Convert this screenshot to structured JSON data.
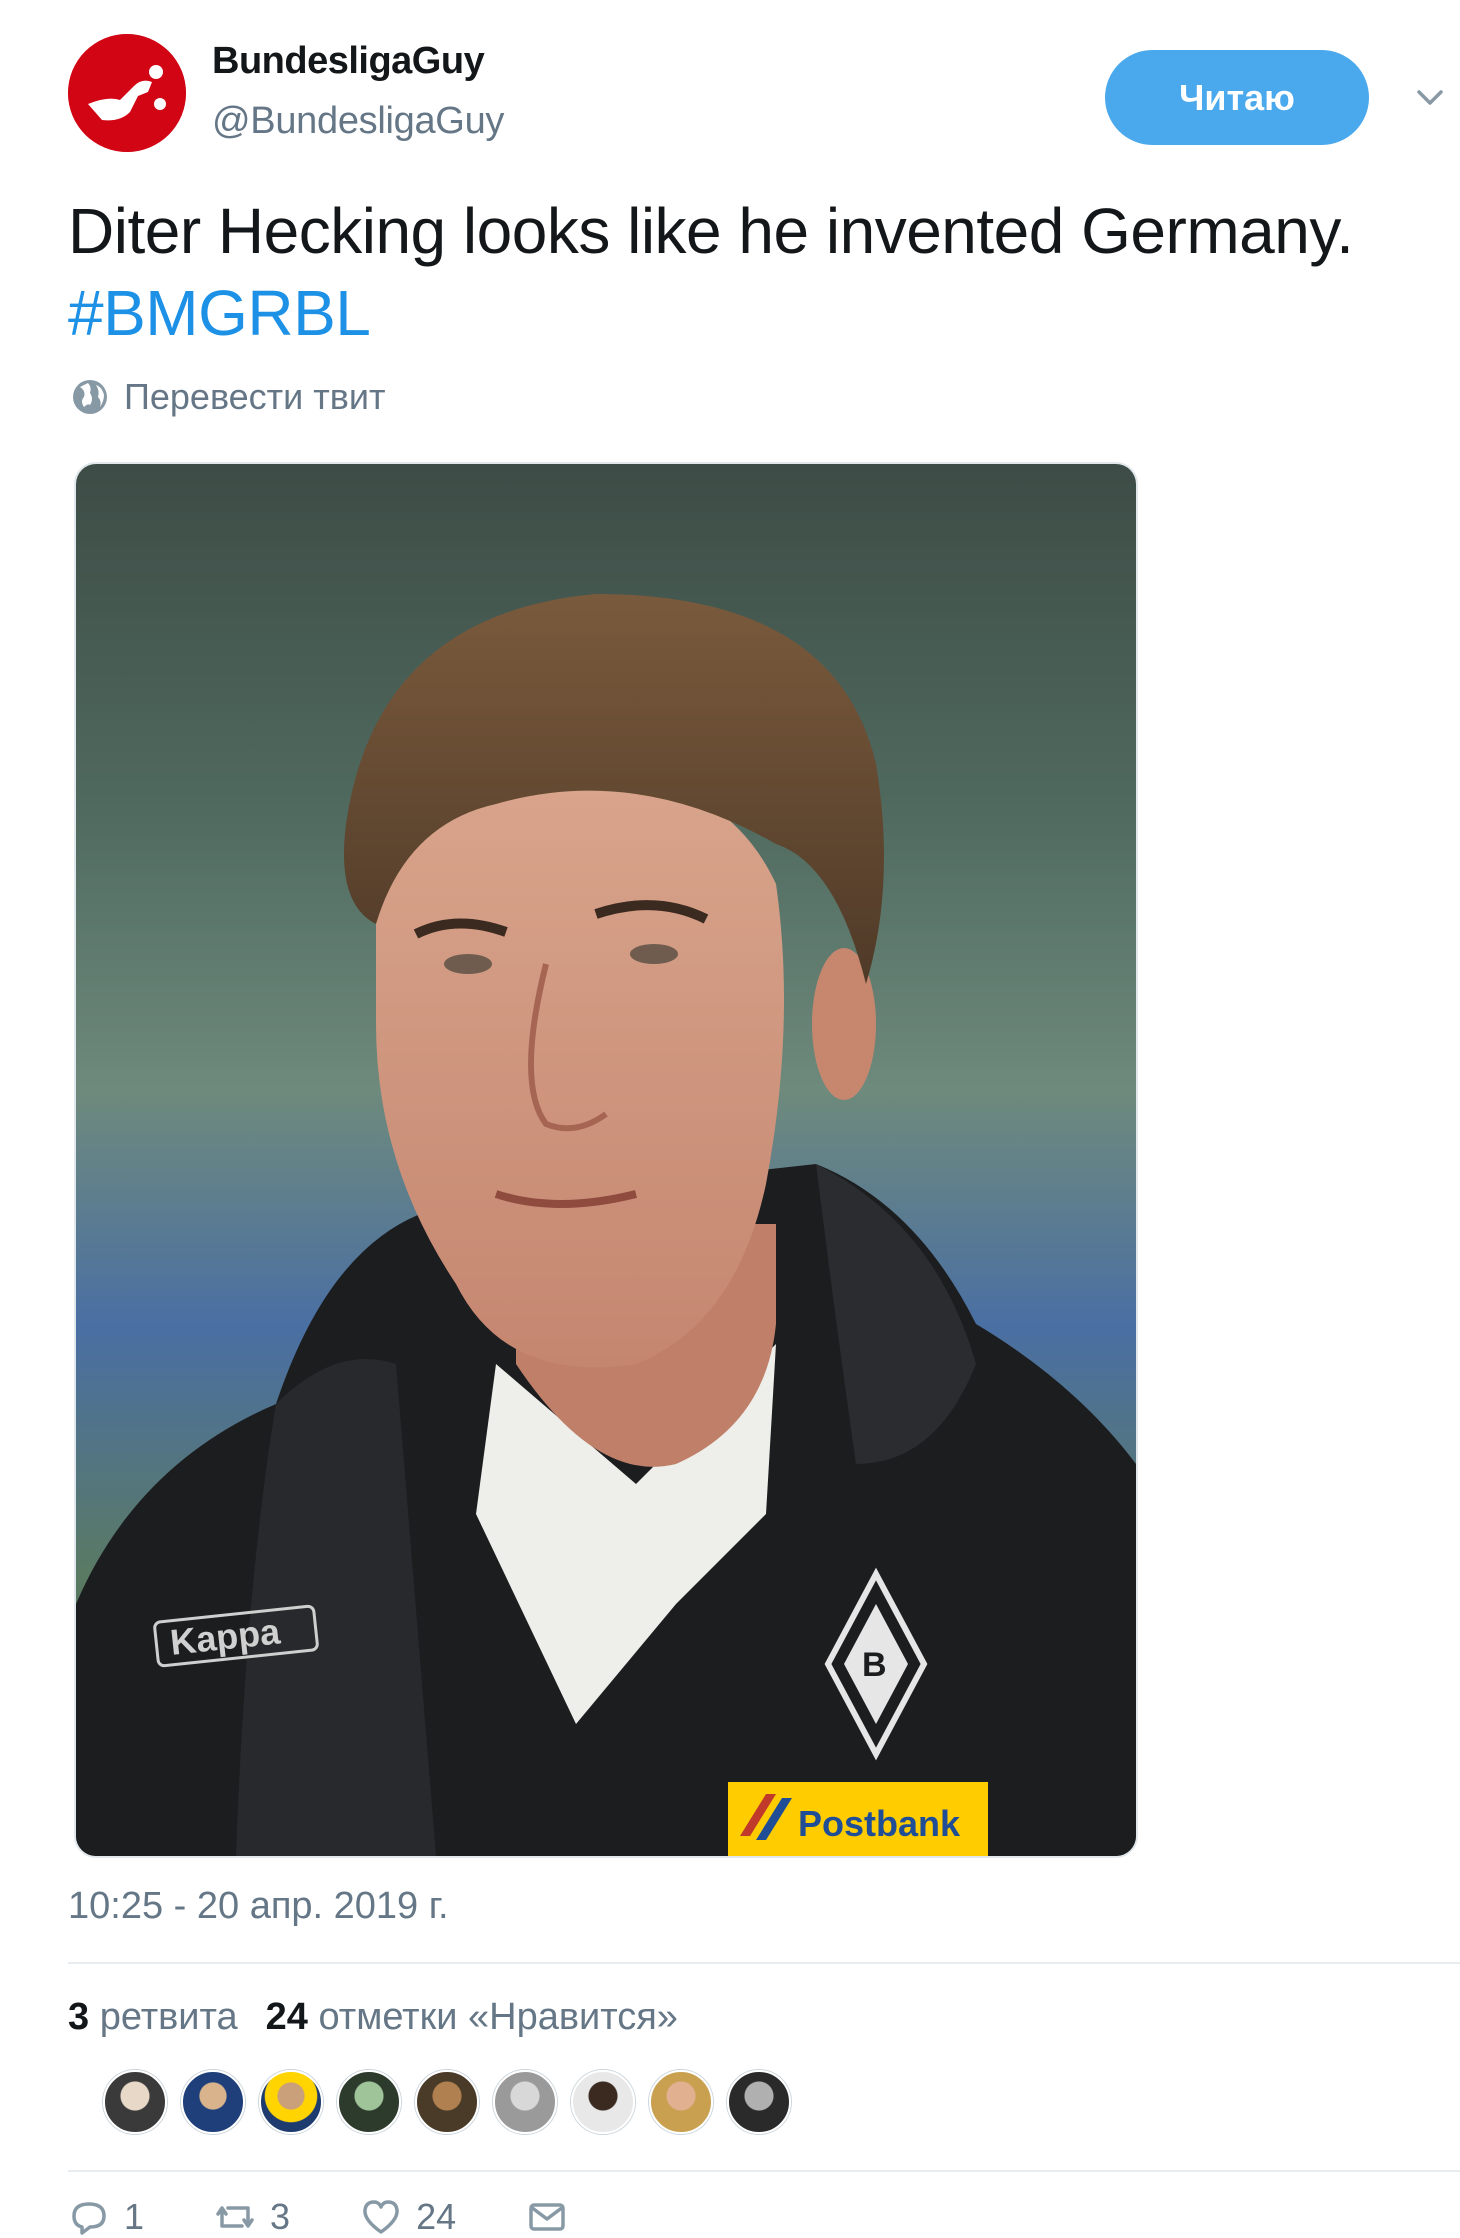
{
  "author": {
    "name": "BundesligaGuy",
    "handle": "@BundesligaGuy"
  },
  "follow_button_label": "Читаю",
  "tweet": {
    "text": "Diter Hecking looks like he invented Germany.",
    "hashtag": "#BMGRBL"
  },
  "translate_label": "Перевести твит",
  "timestamp": "10:25 - 20 апр. 2019 г.",
  "stats": {
    "retweets_count": "3",
    "retweets_label": "ретвита",
    "likes_count": "24",
    "likes_label": "отметки «Нравится»"
  },
  "actions": {
    "reply_count": "1",
    "retweet_count": "3",
    "like_count": "24"
  },
  "colors": {
    "accent": "#1d91e6",
    "follow_button": "#4aa8ec",
    "avatar_red": "#d20515",
    "muted": "#657786"
  },
  "icons": {
    "avatar": "bundesliga-logo-icon",
    "caret": "chevron-down-icon",
    "translate": "globe-icon",
    "reply": "reply-icon",
    "retweet": "retweet-icon",
    "like": "heart-icon",
    "message": "envelope-icon"
  },
  "media": {
    "jersey_brand": "Kappa",
    "sponsor": "Postbank"
  }
}
